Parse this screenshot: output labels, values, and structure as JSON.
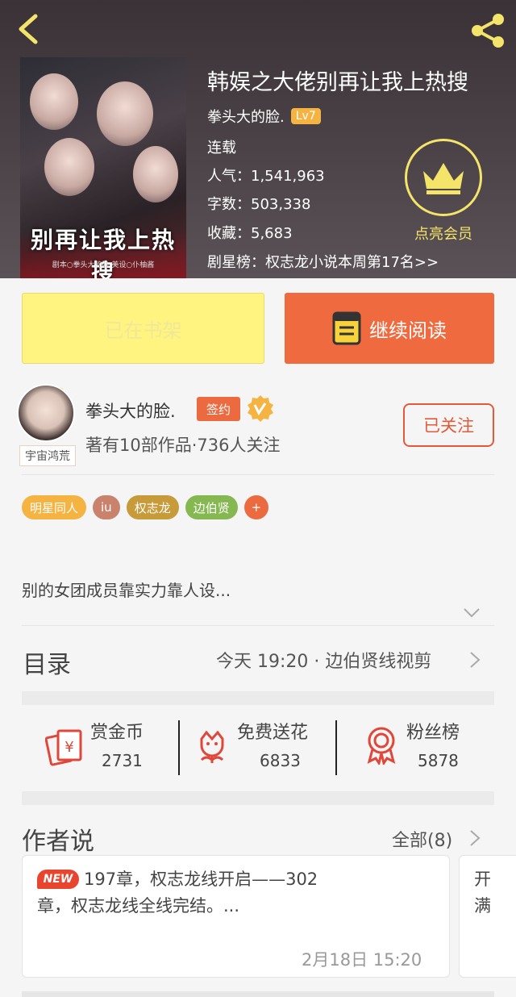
{
  "book": {
    "title": "韩娱之大佬别再让我上热搜",
    "author": "拳头大的脸.",
    "level": "Lv7",
    "status": "连载",
    "popularity": "人气：1,541,963",
    "word_count": "字数：503,338",
    "favorites": "收藏：5,683",
    "ranking": "剧星榜：权志龙小说本周第17名>>",
    "cover_title": "别再让我上热搜",
    "cover_credit": "剧本○拳头大的脸 美设○仆柚酱"
  },
  "vip": {
    "label": "点亮会员",
    "icon": "crown-icon",
    "color": "#f5e46a"
  },
  "actions": {
    "shelf_label": "已在书架",
    "read_label": "继续阅读"
  },
  "author": {
    "name": "拳头大的脸.",
    "sign_badge": "签约",
    "avatar_tag": "宇宙鸿荒",
    "stats": "著有10部作品·736人关注",
    "follow_label": "已关注"
  },
  "tags": [
    {
      "label": "明星同人",
      "color": "#f5b342"
    },
    {
      "label": "iu",
      "color": "#c9826b"
    },
    {
      "label": "权志龙",
      "color": "#c79a3a"
    },
    {
      "label": "边伯贤",
      "color": "#86b851"
    },
    {
      "label": "+",
      "color": "#ec6a3f"
    }
  ],
  "synopsis": "别的女团成员靠实力靠人设...",
  "catalogue": {
    "title": "目录",
    "latest": "今天 19:20 · 边伯贤线视剪"
  },
  "stats": [
    {
      "label": "赏金币",
      "value": "2731",
      "icon": "reward-coin-icon"
    },
    {
      "label": "免费送花",
      "value": "6833",
      "icon": "flower-icon"
    },
    {
      "label": "粉丝榜",
      "value": "5878",
      "icon": "medal-icon"
    }
  ],
  "author_says": {
    "title": "作者说",
    "all_label": "全部(8)",
    "new_badge": "NEW",
    "note": "197章，权志龙线开启——302章，权志龙线全线完结。...",
    "time": "2月18日  15:20",
    "note2": "开满"
  },
  "colors": {
    "accent": "#ef6a3e",
    "shelf": "#fff47f",
    "vip": "#f5e46a"
  }
}
